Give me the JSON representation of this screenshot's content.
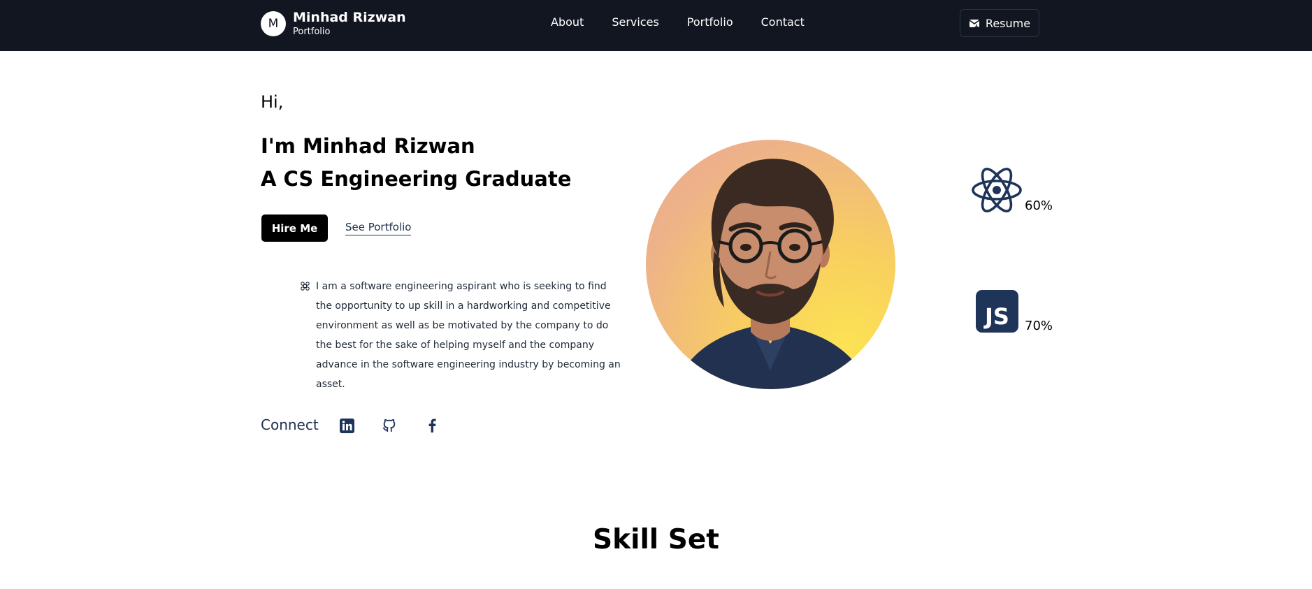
{
  "nav": {
    "brand_initial": "M",
    "brand_name": "Minhad Rizwan",
    "brand_sub": "Portfolio",
    "links": [
      "About",
      "Services",
      "Portfolio",
      "Contact"
    ],
    "resume_label": "Resume"
  },
  "hero": {
    "greeting": "Hi,",
    "title_line1": "I'm Minhad Rizwan",
    "title_line2": "A CS Engineering Graduate",
    "hire_label": "Hire Me",
    "portfolio_label": "See Portfolio",
    "bio": "I am a software engineering aspirant who is seeking to find the opportunity to up skill in a hardworking and competitive environment as well as be motivated by the company to do the best for the sake of helping myself and the company advance in the software engineering industry by becoming an asset.",
    "connect_label": "Connect",
    "socials": [
      "linkedin-icon",
      "github-icon",
      "facebook-icon"
    ]
  },
  "skills": [
    {
      "icon": "react-icon",
      "percent": "60%"
    },
    {
      "icon": "js-icon",
      "label": "JS",
      "percent": "70%"
    }
  ],
  "skillset": {
    "title": "Skill Set"
  },
  "colors": {
    "navbar_bg": "#121620",
    "accent_navy": "#1f3459",
    "button_bg": "#000000"
  }
}
